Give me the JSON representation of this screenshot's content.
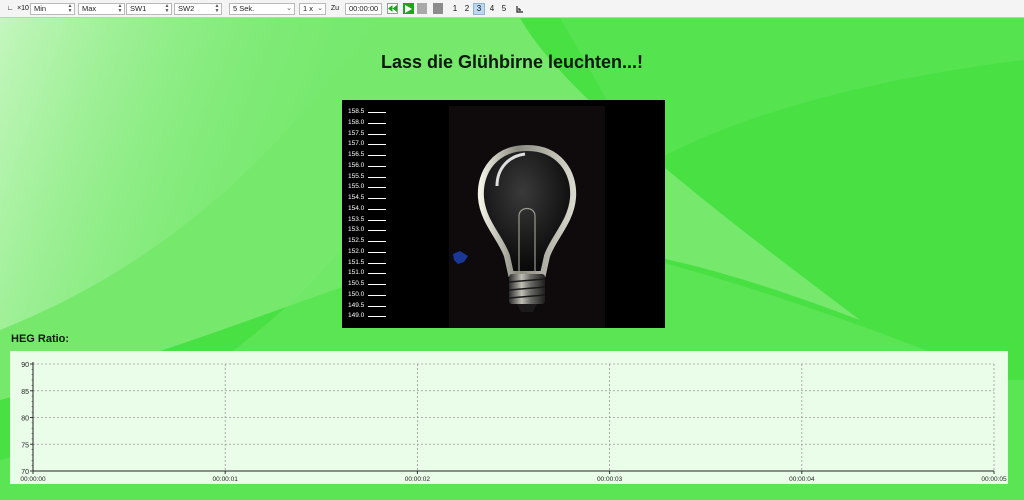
{
  "toolbar": {
    "mode_label": "×10",
    "min_label": "Min",
    "max_label": "Max",
    "sw1_label": "SW1",
    "sw2_label": "SW2",
    "interval": "5 Sek.",
    "speed": "1 x",
    "zu_label": "Zu",
    "time_value": "00:00:00",
    "numbers": [
      "1",
      "2",
      "3",
      "4",
      "5"
    ],
    "active_number": "3"
  },
  "page_title": "Lass die Glühbirne leuchten...!",
  "video_scale": [
    "158.5",
    "158.0",
    "157.5",
    "157.0",
    "156.5",
    "156.0",
    "155.5",
    "155.0",
    "154.5",
    "154.0",
    "153.5",
    "153.0",
    "152.5",
    "152.0",
    "151.5",
    "151.0",
    "150.5",
    "150.0",
    "149.5",
    "149.0"
  ],
  "heg_label": "HEG Ratio:",
  "chart_data": {
    "type": "line",
    "title": "",
    "xlabel": "",
    "ylabel": "",
    "categories": [
      "00:00:00",
      "00:00:01",
      "00:00:02",
      "00:00:03",
      "00:00:04",
      "00:00:05"
    ],
    "y_ticks": [
      "70",
      "75",
      "80",
      "85",
      "90"
    ],
    "ylim": [
      70,
      90
    ],
    "grid": true,
    "series": []
  },
  "colors": {
    "bg_green": "#49e043",
    "chart_bg": "#e9fde9",
    "play_green": "#1aa81a"
  }
}
